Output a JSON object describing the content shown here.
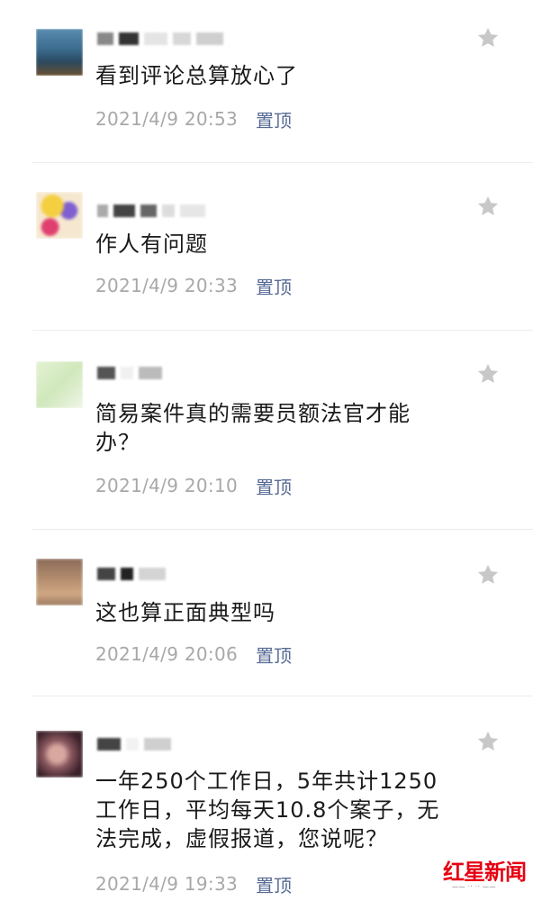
{
  "comments": [
    {
      "text": "看到评论总算放心了",
      "time": "2021/4/9 20:53",
      "pin": "置顶",
      "avatar_colors": [
        "#3a6a8c",
        "#7aa4c8",
        "#4a3a2a"
      ]
    },
    {
      "text": "作人有问题",
      "time": "2021/4/9 20:33",
      "pin": "置顶",
      "avatar_colors": [
        "#e8b830",
        "#c84060",
        "#6050c0"
      ]
    },
    {
      "text": "简易案件真的需要员额法官才能办？",
      "time": "2021/4/9 20:10",
      "pin": "置顶",
      "avatar_colors": [
        "#d8ecc0",
        "#eef6e4",
        "#c8e0b0"
      ]
    },
    {
      "text": "这也算正面典型吗",
      "time": "2021/4/9 20:06",
      "pin": "置顶",
      "avatar_colors": [
        "#a07860",
        "#c8a080",
        "#786048"
      ]
    },
    {
      "text": "一年250个工作日，5年共计1250工作日，平均每天10.8个案子，无法完成，虚假报道，您说呢？",
      "time": "2021/4/9 19:33",
      "pin": "置顶",
      "avatar_colors": [
        "#4a3038",
        "#c89088",
        "#281820"
      ]
    }
  ],
  "watermark": {
    "brand": "红星新闻"
  },
  "colors": {
    "star": "#c8c8c8",
    "pin_link": "#576b95",
    "time": "#a8a8a8",
    "divider": "#ececec"
  },
  "icons": {
    "star": "star-icon"
  }
}
